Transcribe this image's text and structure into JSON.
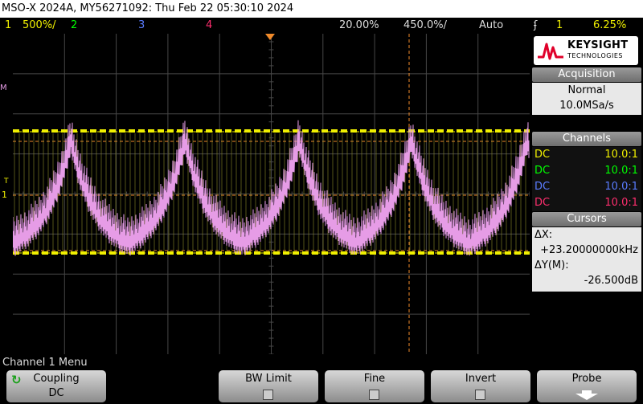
{
  "title": "MSO-X 2024A, MY56271092: Thu Feb 22 05:30:10 2024",
  "status": {
    "ch1_num": "1",
    "ch1_scale": "500%/",
    "ch2_num": "2",
    "ch3_num": "3",
    "ch4_num": "4",
    "timebase": "20.00%",
    "delay": "450.0%/",
    "trigger_mode": "Auto",
    "trigger_icon": "rising-edge-icon",
    "trigger_source": "1",
    "trigger_level": "6.25%"
  },
  "logo": {
    "line1": "KEYSIGHT",
    "line2": "TECHNOLOGIES"
  },
  "acquisition": {
    "header": "Acquisition",
    "mode": "Normal",
    "rate": "10.0MSa/s"
  },
  "channels": {
    "header": "Channels",
    "rows": [
      {
        "coupling": "DC",
        "probe": "10.0:1",
        "color": "#f0f000"
      },
      {
        "coupling": "DC",
        "probe": "10.0:1",
        "color": "#00ff00"
      },
      {
        "coupling": "DC",
        "probe": "10.0:1",
        "color": "#5a7cff"
      },
      {
        "coupling": "DC",
        "probe": "10.0:1",
        "color": "#ff2e6e"
      }
    ]
  },
  "cursors": {
    "header": "Cursors",
    "dx_label": "ΔX:",
    "dx_value": "+23.20000000kHz",
    "dy_label": "ΔY(M):",
    "dy_value": "-26.500dB"
  },
  "menu": {
    "title": "Channel 1 Menu"
  },
  "softkeys": {
    "coupling": "Coupling",
    "coupling_value": "DC",
    "bwlimit": "BW Limit",
    "fine": "Fine",
    "invert": "Invert",
    "probe": "Probe"
  },
  "markers": {
    "math_marker": "M",
    "trigger_marker": "T",
    "ch1_marker": "1"
  },
  "colors": {
    "trace_math": "#e69ce6",
    "grid": "#4a4a4a",
    "cursor": "#f08a2a",
    "ch1": "#f0f000"
  }
}
